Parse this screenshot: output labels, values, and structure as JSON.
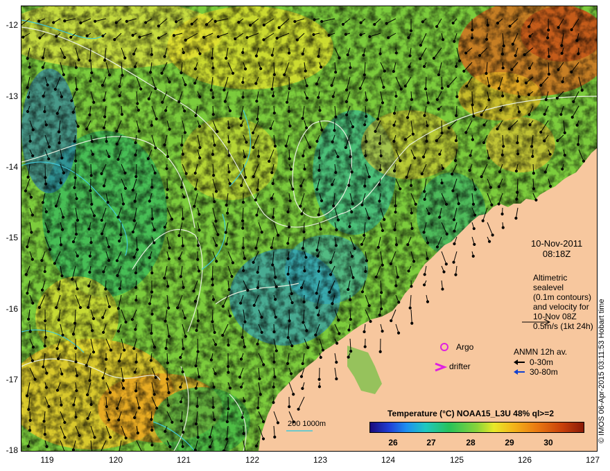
{
  "map": {
    "y_axis_labels": [
      "-12",
      "-13",
      "-14",
      "-15",
      "-16",
      "-17",
      "-18"
    ],
    "x_axis_labels": [
      "119",
      "120",
      "121",
      "122",
      "123",
      "124",
      "125",
      "126",
      "127"
    ],
    "date": "10-Nov-2011",
    "time": "08:18Z",
    "altimetry_lines": [
      "Altimetric sealevel",
      "(0.1m contours)",
      "and velocity for",
      "10-Nov 08Z",
      "0.5m/s (1kt 24h)"
    ],
    "argo_label": "Argo",
    "drifter_label": "drifter",
    "anmn_title": "ANMN 12h av.",
    "anmn_shallow": "0-30m",
    "anmn_deep": "30-80m",
    "bathymetry_label": "200  1000m",
    "colorbar_title": "Temperature (°C) NOAA15_L3U 48% ql>=2",
    "colorbar_ticks": [
      "26",
      "27",
      "28",
      "29",
      "30"
    ],
    "credit": "© IMOS 06-Apr-2015 03:11:53 Hobart time",
    "colors": {
      "land": "#f7c79e",
      "contour": "#e8f0e0",
      "bathy": "#40c8d8",
      "marker": "#e020e0",
      "deep_arrow": "#1040d0"
    }
  }
}
